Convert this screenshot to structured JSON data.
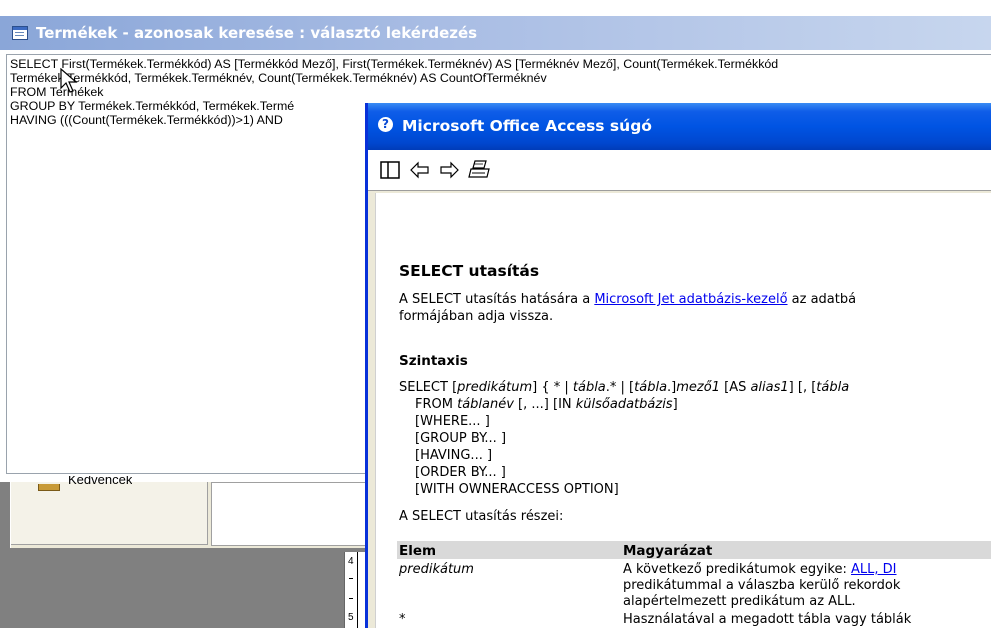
{
  "query_window": {
    "title": "Termékek - azonosak keresése : választó lekérdezés",
    "sql_lines": [
      "SELECT First(Termékek.Termékkód) AS [Termékkód Mező], First(Termékek.Terméknév) AS [Terméknév Mező], Count(Termékek.Termékkód",
      "Termékek.Termékkód, Termékek.Terméknév, Count(Termékek.Terméknév) AS CountOfTerméknév",
      "FROM Termékek",
      "GROUP BY Termékek.Termékkód, Termékek.Termé",
      "HAVING (((Count(Termékek.Termékkód))>1) AND"
    ]
  },
  "db_window": {
    "favorites_label": "Kedvencek",
    "grid_row_numbers": [
      "4",
      "5"
    ]
  },
  "help_window": {
    "title": "Microsoft Office Access súgó",
    "toolbar": {
      "toggle_pane_icon": "pane-toggle-icon",
      "back_icon": "back-arrow-icon",
      "forward_icon": "forward-arrow-icon",
      "print_icon": "printer-icon"
    },
    "heading": "SELECT utasítás",
    "intro_prefix": "A SELECT utasítás hatására a ",
    "intro_link": "Microsoft Jet adatbázis-kezelő",
    "intro_suffix": " az adatbá",
    "intro_line2": "formájában adja vissza.",
    "syntax_heading": "Szintaxis",
    "syntax": {
      "l1_a": "SELECT [",
      "l1_pred": "predikátum",
      "l1_b": "] { * | ",
      "l1_tabla": "tábla",
      "l1_c": ".* | [",
      "l1_tabla2": "tábla",
      "l1_d": ".]",
      "l1_mezo": "mező1",
      "l1_e": " [AS ",
      "l1_alias": "alias1",
      "l1_f": "] [, [",
      "l1_tabla3": "tábla",
      "l2_a": "FROM ",
      "l2_tablanev": "táblanév",
      "l2_b": " [, ...] [IN ",
      "l2_kulso": "külsőadatbázis",
      "l2_c": "]",
      "lines": [
        "[WHERE... ]",
        "[GROUP BY... ]",
        "[HAVING... ]",
        "[ORDER BY... ]",
        "[WITH OWNERACCESS OPTION]"
      ]
    },
    "parts_text": "A SELECT utasítás részei:",
    "table": {
      "headers": [
        "Elem",
        "Magyarázat"
      ],
      "rows": [
        {
          "elem": "predikátum",
          "desc_prefix": "A következő predikátumok egyike: ",
          "desc_link": "ALL, DI",
          "desc_line2": "predikátummal a válaszba kerülő rekordok",
          "desc_line3": "alapértelmezett predikátum az ALL."
        },
        {
          "elem": "*",
          "desc_prefix": "Használatával a megadott tábla vagy táblák"
        }
      ]
    }
  }
}
